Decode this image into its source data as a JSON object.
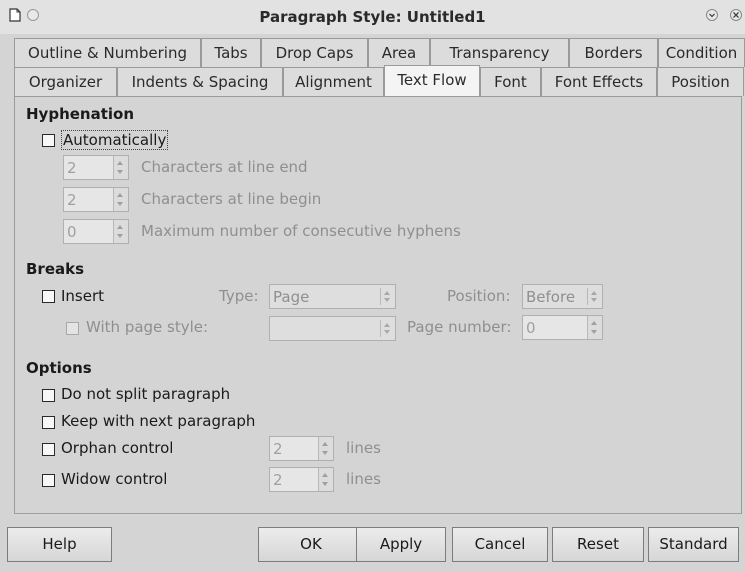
{
  "window": {
    "title": "Paragraph Style: Untitled1"
  },
  "tabs_row1": [
    {
      "label": "Outline & Numbering"
    },
    {
      "label": "Tabs"
    },
    {
      "label": "Drop Caps"
    },
    {
      "label": "Area"
    },
    {
      "label": "Transparency"
    },
    {
      "label": "Borders"
    },
    {
      "label": "Condition"
    }
  ],
  "tabs_row2": [
    {
      "label": "Organizer"
    },
    {
      "label": "Indents & Spacing"
    },
    {
      "label": "Alignment"
    },
    {
      "label": "Text Flow",
      "active": true
    },
    {
      "label": "Font"
    },
    {
      "label": "Font Effects"
    },
    {
      "label": "Position"
    }
  ],
  "hyphenation": {
    "heading": "Hyphenation",
    "automatically": "Automatically",
    "chars_end_value": "2",
    "chars_end_label": "Characters at line end",
    "chars_begin_value": "2",
    "chars_begin_label": "Characters at line begin",
    "max_hyphens_value": "0",
    "max_hyphens_label": "Maximum number of consecutive hyphens"
  },
  "breaks": {
    "heading": "Breaks",
    "insert": "Insert",
    "type_label": "Type:",
    "type_value": "Page",
    "position_label": "Position:",
    "position_value": "Before",
    "with_page_style": "With page style:",
    "page_style_value": "",
    "page_number_label": "Page number:",
    "page_number_value": "0"
  },
  "options": {
    "heading": "Options",
    "do_not_split": "Do not split paragraph",
    "keep_with_next": "Keep with next paragraph",
    "orphan": "Orphan control",
    "orphan_value": "2",
    "orphan_unit": "lines",
    "widow": "Widow control",
    "widow_value": "2",
    "widow_unit": "lines"
  },
  "buttons": {
    "help": "Help",
    "ok": "OK",
    "apply": "Apply",
    "cancel": "Cancel",
    "reset": "Reset",
    "standard": "Standard"
  }
}
